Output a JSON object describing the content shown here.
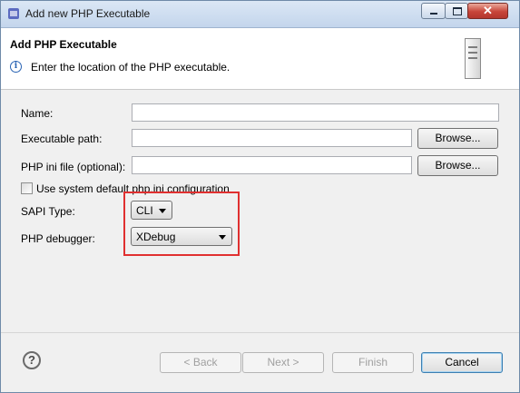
{
  "window": {
    "title": "Add new PHP Executable"
  },
  "header": {
    "title": "Add PHP Executable",
    "message": "Enter the location of the PHP executable."
  },
  "form": {
    "name_label": "Name:",
    "name_value": "",
    "exec_label": "Executable path:",
    "exec_value": "",
    "ini_label": "PHP ini file (optional):",
    "ini_value": "",
    "browse_label": "Browse...",
    "checkbox_label": "Use system default php.ini configuration",
    "checkbox_checked": false,
    "sapi_label": "SAPI Type:",
    "sapi_value": "CLI",
    "debugger_label": "PHP debugger:",
    "debugger_value": "XDebug"
  },
  "footer": {
    "back_label": "< Back",
    "next_label": "Next >",
    "finish_label": "Finish",
    "cancel_label": "Cancel"
  },
  "colors": {
    "highlight": "#e03030"
  },
  "icons": [
    "php-icon",
    "minimize-icon",
    "maximize-icon",
    "close-icon",
    "info-icon",
    "server-icon",
    "help-icon",
    "chevron-down-icon"
  ]
}
